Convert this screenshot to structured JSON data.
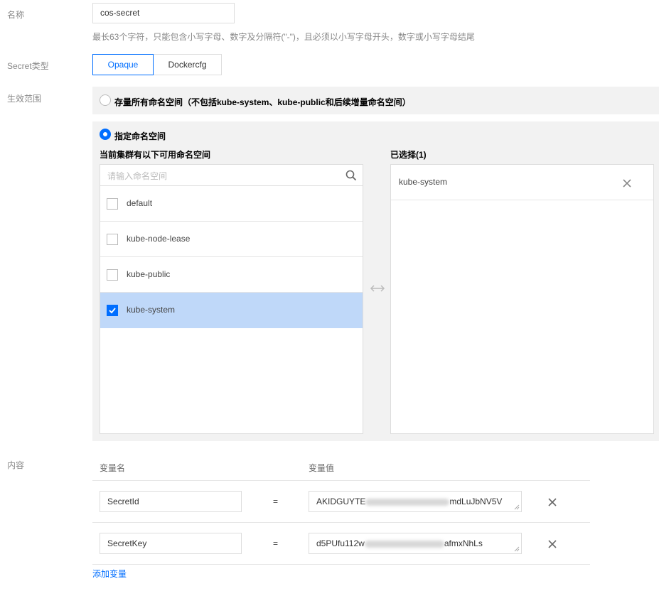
{
  "form": {
    "name_label": "名称",
    "name_value": "cos-secret",
    "name_hint": "最长63个字符，只能包含小写字母、数字及分隔符(\"-\")，且必须以小写字母开头，数字或小写字母结尾",
    "type_label": "Secret类型",
    "type_options": [
      "Opaque",
      "Dockercfg"
    ],
    "type_selected": "Opaque",
    "scope_label": "生效范围",
    "scope_option_all": "存量所有命名空间（不包括kube-system、kube-public和后续增量命名空间）",
    "scope_option_specific": "指定命名空间",
    "scope_selected": "指定命名空间"
  },
  "namespaces": {
    "available_title": "当前集群有以下可用命名空间",
    "search_placeholder": "请输入命名空间",
    "items": [
      {
        "label": "default",
        "checked": false
      },
      {
        "label": "kube-node-lease",
        "checked": false
      },
      {
        "label": "kube-public",
        "checked": false
      },
      {
        "label": "kube-system",
        "checked": true
      }
    ],
    "selected_title": "已选择(1)",
    "selected_items": [
      {
        "label": "kube-system"
      }
    ]
  },
  "content": {
    "label": "内容",
    "col_name": "变量名",
    "col_value": "变量值",
    "rows": [
      {
        "name": "SecretId",
        "value_prefix": "AKIDGUYTE",
        "value_suffix": "mdLuJbNV5V"
      },
      {
        "name": "SecretKey",
        "value_prefix": "d5PUfu112w",
        "value_suffix": "afmxNhLs"
      }
    ],
    "equals": "=",
    "add_label": "添加变量"
  },
  "colors": {
    "accent": "#006eff",
    "selected_row": "#bfd8f9",
    "panel_bg": "#f2f2f2"
  }
}
